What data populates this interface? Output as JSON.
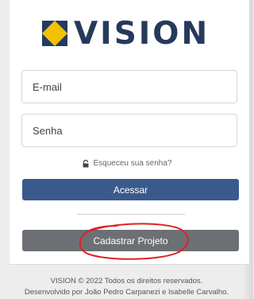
{
  "brand": {
    "name": "VISION",
    "colors": {
      "navy": "#253a5c",
      "yellow": "#f2c200"
    }
  },
  "form": {
    "email_placeholder": "E-mail",
    "password_placeholder": "Senha",
    "forgot_link": "Esqueceu sua senha?",
    "forgot_icon": "lock-icon"
  },
  "buttons": {
    "login_label": "Acessar",
    "register_label": "Cadastrar Projeto",
    "login_color": "#3b5a8c",
    "register_color": "#6c7075"
  },
  "annotation": {
    "color": "#e02020",
    "shape": "hand-drawn-ellipse"
  },
  "footer": {
    "line1": "VISION © 2022 Todos os direitos reservados.",
    "line2": "Desenvolvido por João Pedro Carpanezi e Isabelle Carvalho."
  }
}
